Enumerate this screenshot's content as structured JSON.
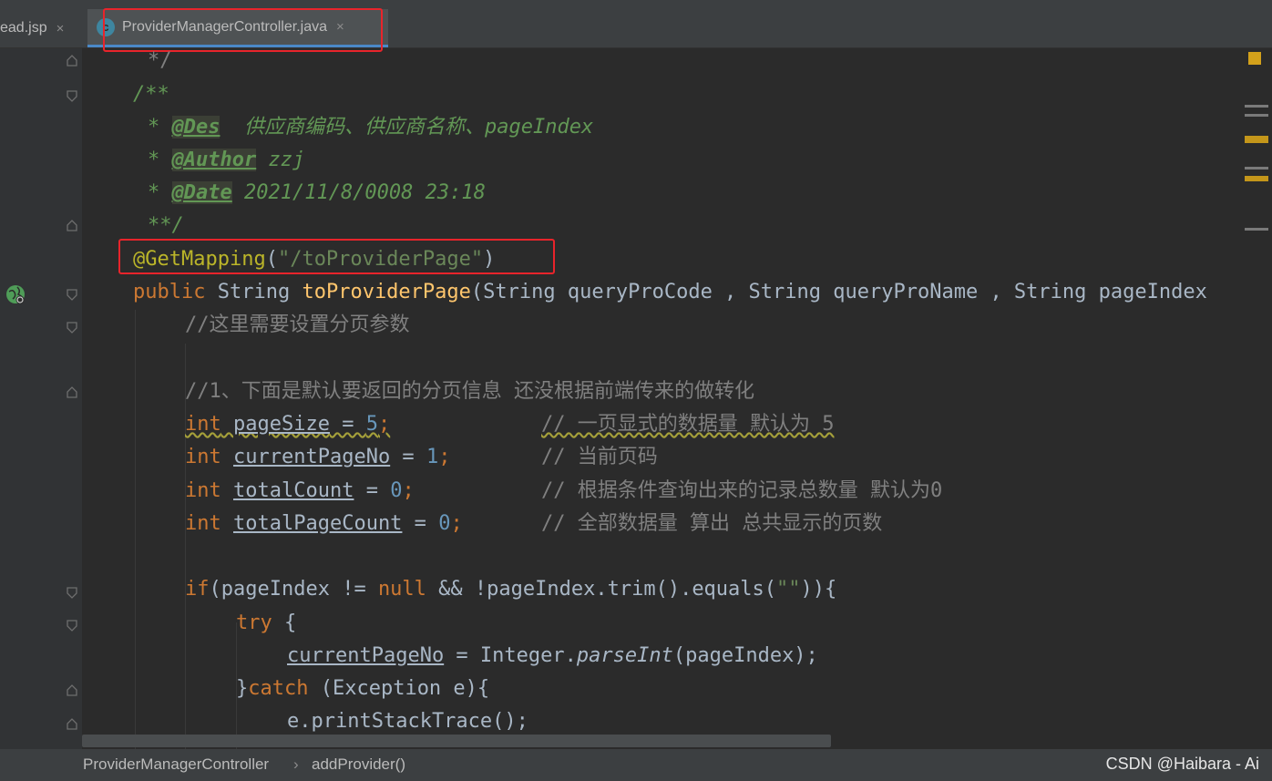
{
  "tabs": {
    "inactive_label": "ead.jsp",
    "active_label": "ProviderManagerController.java",
    "close_glyph": "×",
    "class_icon_letter": "c"
  },
  "code": {
    "l1": "*/",
    "l2": "/**",
    "l3_tag": "@Des",
    "l3_text": "  供应商编码、供应商名称、pageIndex",
    "l4_tag": "@Author",
    "l4_text": " zzj",
    "l5_tag": "@Date",
    "l5_text": " 2021/11/8/0008 23:18",
    "l6": "**/",
    "annotation": "@GetMapping",
    "mapping_path": "\"/toProviderPage\"",
    "method_kw": "public",
    "method_type": "String",
    "method_name": "toProviderPage",
    "method_params": "(String queryProCode , String queryProName , String pageIndex",
    "c1": "//这里需要设置分页参数",
    "c2": "//1、下面是默认要返回的分页信息 还没根据前端传来的做转化",
    "vars": [
      {
        "type": "int",
        "name": "pageSize",
        "value": "5",
        "comment": "// 一页显式的数据量 默认为 5"
      },
      {
        "type": "int",
        "name": "currentPageNo",
        "value": "1",
        "comment": "// 当前页码"
      },
      {
        "type": "int",
        "name": "totalCount",
        "value": "0",
        "comment": "// 根据条件查询出来的记录总数量 默认为0"
      },
      {
        "type": "int",
        "name": "totalPageCount",
        "value": "0",
        "comment": "// 全部数据量 算出 总共显示的页数"
      }
    ],
    "if_kw": "if",
    "if_cond_a": "(pageIndex != ",
    "null_kw": "null",
    "if_cond_b": " && !pageIndex.trim().equals(",
    "empty_str": "\"\"",
    "if_cond_c": ")){",
    "try_kw": "try",
    "try_rest": " {",
    "assign_field": "currentPageNo",
    "assign_mid": " = Integer.",
    "parse_fn": "parseInt",
    "assign_end": "(pageIndex);",
    "catch_open": "}",
    "catch_kw": "catch",
    "catch_rest": " (Exception e){",
    "print_stmt": "e.printStackTrace();"
  },
  "breadcrumb": {
    "class_name": "ProviderManagerController",
    "separator": "›",
    "method_name": "addProvider()"
  },
  "watermark": "CSDN @Haibara - Ai",
  "colors": {
    "highlight_box": "#e8242b",
    "keyword": "#cc7832",
    "string": "#6a8759",
    "number": "#6897bb",
    "annotation": "#bbb529",
    "method": "#ffc66d",
    "doc_comment": "#629755"
  }
}
